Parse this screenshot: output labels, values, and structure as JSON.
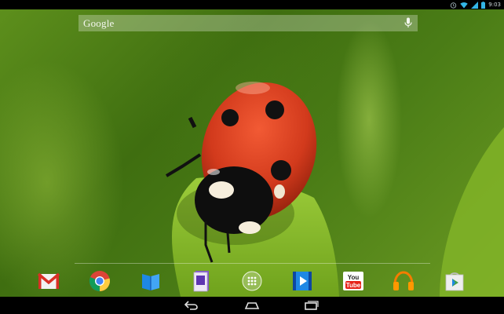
{
  "status_bar": {
    "time": "9:03",
    "icons": [
      "alarm-icon",
      "wifi-icon",
      "signal-icon",
      "battery-icon"
    ]
  },
  "search_bar": {
    "label": "Google",
    "mic_icon": "microphone-icon"
  },
  "dock": {
    "apps": [
      {
        "name": "Gmail",
        "icon": "gmail-icon"
      },
      {
        "name": "Chrome",
        "icon": "chrome-icon"
      },
      {
        "name": "Play Books",
        "icon": "play-books-icon"
      },
      {
        "name": "Play Magazines",
        "icon": "play-magazines-icon"
      },
      {
        "name": "All Apps",
        "icon": "app-drawer-icon"
      },
      {
        "name": "Play Movies",
        "icon": "play-movies-icon"
      },
      {
        "name": "YouTube",
        "icon": "youtube-icon",
        "label": "You Tube"
      },
      {
        "name": "Play Music",
        "icon": "play-music-icon"
      },
      {
        "name": "Play Store",
        "icon": "play-store-icon"
      }
    ]
  },
  "nav_bar": {
    "buttons": [
      "back-icon",
      "home-icon",
      "recent-apps-icon"
    ]
  },
  "colors": {
    "wallpaper_green": "#4a7c16",
    "ladybug_red": "#d23a1c",
    "status_icon": "#33b5e5"
  }
}
